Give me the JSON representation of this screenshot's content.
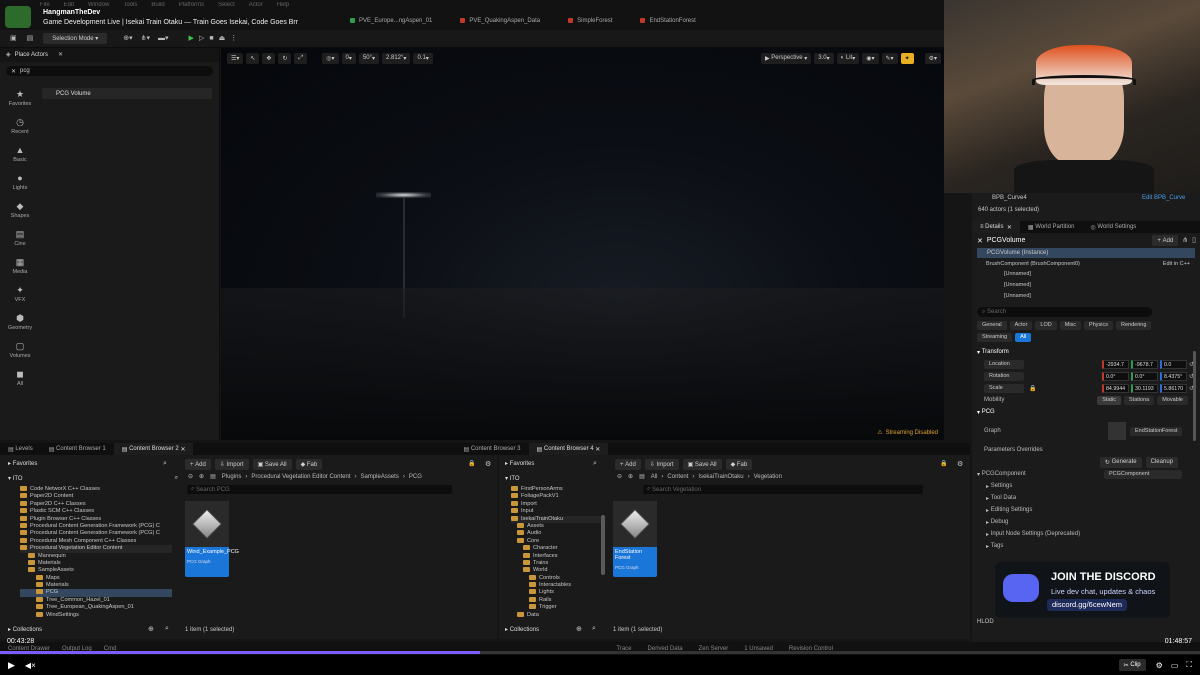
{
  "stream": {
    "channel": "HangmanTheDev",
    "title": "Game Development Live | Isekai Train Otaku — Train Goes Isekai, Code Goes Brr",
    "time_elapsed": "00:43:28",
    "time_total": "01:48:57",
    "clip_label": "Clip",
    "progress_fraction": 0.4
  },
  "menu": [
    "File",
    "Edit",
    "Window",
    "Tools",
    "Build",
    "Platforms",
    "Select",
    "Actor",
    "Help"
  ],
  "level_tabs": [
    {
      "label": "PVE_Europe...ngAspen_01",
      "color": "#2e9e4e"
    },
    {
      "label": "PVE_QuakingAspen_Data",
      "color": "#c0392b"
    },
    {
      "label": "SimpleForest",
      "color": "#c0392b"
    },
    {
      "label": "EndStationForest",
      "color": "#c0392b"
    }
  ],
  "toolbar": {
    "selection_mode": "Selection Mode"
  },
  "place_actors": {
    "title": "Place Actors",
    "search": "pcg",
    "result": "PCG Volume",
    "categories": [
      "Favorites",
      "Recent",
      "Basic",
      "Lights",
      "Shapes",
      "Cine",
      "Media",
      "VFX",
      "Geometry",
      "Volumes",
      "All"
    ]
  },
  "viewport": {
    "perspective": "Perspective",
    "lit": "Lit",
    "speed": "3.0",
    "snap_rot": "50°",
    "snap_scale": "2.812°",
    "snap_grid": "0.1",
    "zero": "0",
    "warning": "Streaming Disabled"
  },
  "bottom_tabs": [
    "Levels",
    "Content Browser 1",
    "Content Browser 2",
    "Content Browser 3",
    "Content Browser 4"
  ],
  "cb_left": {
    "add": "Add",
    "import": "Import",
    "save_all": "Save All",
    "fab": "Fab",
    "favorites": "Favorites",
    "root": "ITO",
    "collections": "Collections",
    "search": "Search PCG",
    "breadcrumb": [
      "Plugins",
      "Procedural Vegetation Editor Content",
      "SampleAssets",
      "PCG"
    ],
    "tree": [
      "Code NetworX C++ Classes",
      "Paper2D Content",
      "Paper2D C++ Classes",
      "Plastic SCM C++ Classes",
      "Plugin Browser C++ Classes",
      "Procedural Content Generation Framework (PCG) C",
      "Procedural Content Generation Framework (PCG) C",
      "Procedural Mesh Component C++ Classes",
      "Procedural Vegetation Editor Content",
      "Mannequin",
      "Materials",
      "SampleAssets",
      "Maps",
      "Materials",
      "PCG",
      "Tree_Common_Hazel_01",
      "Tree_European_QuakingAspen_01",
      "WindSettings"
    ],
    "asset_name": "Wind_Example_PCG",
    "asset_type": "PCG Graph",
    "count": "1 item (1 selected)"
  },
  "cb_right": {
    "add": "Add",
    "import": "Import",
    "save_all": "Save All",
    "fab": "Fab",
    "favorites": "Favorites",
    "root": "ITO",
    "collections": "Collections",
    "search": "Search Vegetation",
    "breadcrumb": [
      "All",
      "Content",
      "IsekaiTrainOtaku",
      "Vegetation"
    ],
    "tree": [
      "FirstPersonArms",
      "FoliagePackV1",
      "Import",
      "Input",
      "IsekaiTrainOtaku",
      "Assets",
      "Audio",
      "Core",
      "Character",
      "Interfaces",
      "Trains",
      "World",
      "Controls",
      "Interactables",
      "Lights",
      "Rails",
      "Trigger",
      "Data"
    ],
    "asset_name": "EndStation Forest",
    "asset_type": "PCG Graph",
    "count": "1 item (1 selected)"
  },
  "outliner": {
    "item": "BPB_Curve4",
    "edit_link": "Edit BPB_Curve",
    "actors": "640 actors (1 selected)"
  },
  "details": {
    "tabs": [
      "Details",
      "World Partition",
      "World Settings"
    ],
    "actor": "PCGVolume",
    "add": "Add",
    "instance": "PCGVolume (Instance)",
    "brush": "BrushComponent (BrushComponent0)",
    "edit_cpp": "Edit in C++",
    "unnamed": [
      "[Unnamed]",
      "[Unnamed]",
      "[Unnamed]"
    ],
    "search": "Search",
    "filters": [
      "General",
      "Actor",
      "LOD",
      "Misc",
      "Physics",
      "Rendering",
      "Streaming",
      "All"
    ],
    "transform": "Transform",
    "location": [
      "Location",
      "-2934.7",
      "-9678.7",
      "0.0"
    ],
    "rotation": [
      "Rotation",
      "0.0°",
      "0.0°",
      "8.4375°"
    ],
    "scale": [
      "Scale",
      "84.9944",
      "30.1193",
      "5.86170"
    ],
    "mobility": [
      "Mobility",
      "Static",
      "Stationa",
      "Movable"
    ],
    "pcg": "PCG",
    "graph": "Graph",
    "graph_value": "EndStationForest",
    "param_overrides": "Parameters Overrides",
    "generate": "Generate",
    "cleanup": "Cleanup",
    "pcg_component": "PCGComponent",
    "pcg_component_value": "PCGComponent",
    "sections": [
      "Settings",
      "Tool Data",
      "Editing Settings",
      "Debug",
      "Input Node Settings (Deprecated)",
      "Tags"
    ],
    "hlod": "HLOD"
  },
  "discord": {
    "title": "JOIN THE DISCORD",
    "subtitle": "Live dev chat, updates & chaos",
    "link": "discord.gg/6cewNem"
  },
  "statusbar": [
    "Content Drawer",
    "Output Log",
    "Cmd",
    "Trace",
    "Derived Data",
    "Zen Server",
    "1 Unsaved",
    "Revision Control"
  ]
}
